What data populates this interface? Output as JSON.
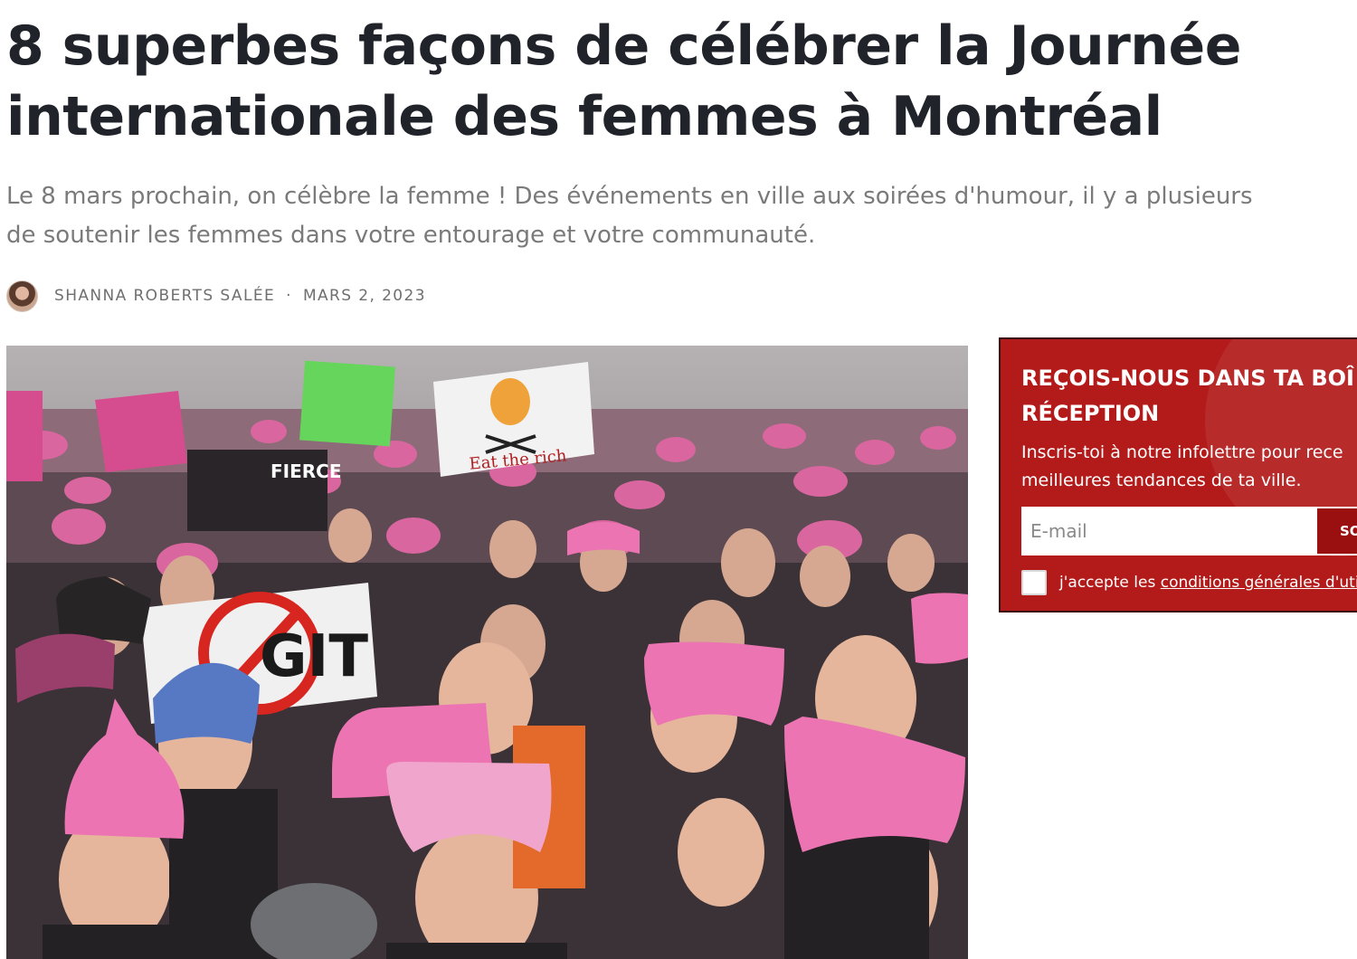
{
  "article": {
    "title_line1": "8 superbes façons de célébrer la Journée",
    "title_line2": "internationale des femmes à Montréal",
    "dek_line1": "Le 8 mars prochain, on célèbre la femme ! Des événements en ville aux soirées d'humour, il y a plusieurs",
    "dek_line2": "de soutenir les femmes dans votre entourage et votre communauté.",
    "author": "SHANNA ROBERTS SALÉE",
    "separator": "·",
    "date": "MARS 2, 2023"
  },
  "hero": {
    "sign_eat": "Eat the rich",
    "sign_fierce": "FIERCE",
    "sign_bigot": "GIT"
  },
  "newsletter": {
    "title_line1": "REÇOIS-NOUS DANS TA BOÎ",
    "title_line2": "RÉCEPTION",
    "text_line1": "Inscris-toi à notre infolettre pour rece",
    "text_line2": "meilleures tendances de ta ville.",
    "email_placeholder": "E-mail",
    "submit_label": "SO",
    "consent_prefix": "j'accepte les",
    "consent_link": "conditions générales d'uti"
  },
  "colors": {
    "newsletter_bg": "#b31b1b",
    "hat_pink": "#e0569a"
  }
}
